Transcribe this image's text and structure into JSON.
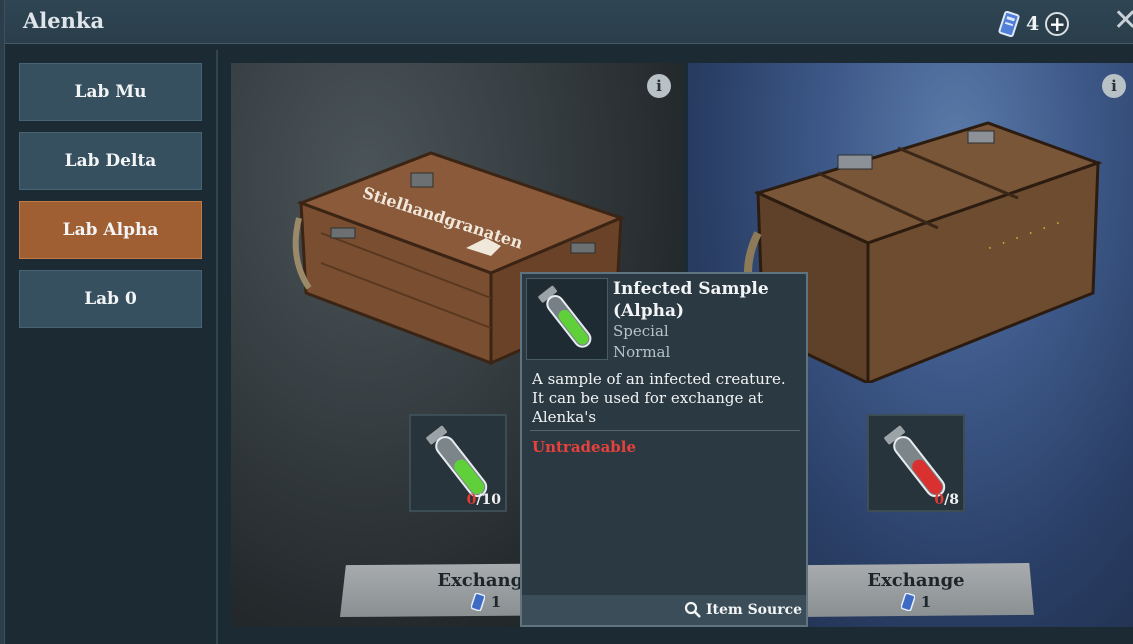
{
  "window": {
    "title": "Alenka",
    "ticket_count": "4",
    "icons": [
      "ticket-icon",
      "plus-icon",
      "close-icon"
    ]
  },
  "sidebar": {
    "items": [
      {
        "label": "Lab Mu",
        "active": false
      },
      {
        "label": "Lab Delta",
        "active": false
      },
      {
        "label": "Lab Alpha",
        "active": true
      },
      {
        "label": "Lab 0",
        "active": false
      }
    ]
  },
  "cards": [
    {
      "crate_label": "Stielhandgranaten",
      "item_icon": "green-sample-tube",
      "count_current": "0",
      "count_total": "/10",
      "button_label": "Exchange",
      "cost": "1"
    },
    {
      "item_icon": "red-sample-tube",
      "count_current": "0",
      "count_total": "/8",
      "button_label": "Exchange",
      "cost": "1"
    }
  ],
  "tooltip": {
    "name": "Infected Sample (Alpha)",
    "rarity": "Special",
    "quality": "Normal",
    "description": "A sample of an infected creature. It can be used for exchange at Alenka's",
    "trade_status": "Untradeable",
    "source_label": "Item Source"
  },
  "colors": {
    "active_tab": "#a05f33",
    "tab": "#36505f",
    "untradeable": "#e8413b",
    "count_zero": "#e23a33"
  }
}
